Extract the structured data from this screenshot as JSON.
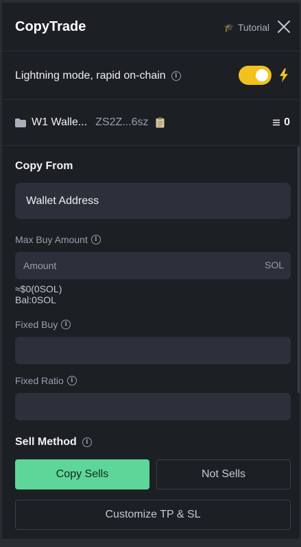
{
  "header": {
    "title": "CopyTrade",
    "tutorial_label": "Tutorial",
    "tutorial_icon": "graduation-cap-icon",
    "close_icon": "close-icon"
  },
  "lightning": {
    "label": "Lightning mode, rapid on-chain",
    "enabled": true,
    "toggle_color": "#f2c11d"
  },
  "wallet": {
    "name": "W1 Walle...",
    "address": "ZS2Z...6sz",
    "balance": "0"
  },
  "copy_from": {
    "label": "Copy From",
    "placeholder": "Wallet Address"
  },
  "max_buy": {
    "label": "Max Buy Amount",
    "placeholder": "Amount",
    "unit": "SOL",
    "estimate": "≈$0(0SOL)",
    "balance": "Bal:0SOL"
  },
  "fixed_buy": {
    "label": "Fixed Buy"
  },
  "fixed_ratio": {
    "label": "Fixed Ratio"
  },
  "sell_method": {
    "label": "Sell Method",
    "options": [
      "Copy Sells",
      "Not Sells"
    ],
    "selected": "Copy Sells",
    "accent": "#5ed69a",
    "customize_label": "Customize TP & SL"
  }
}
